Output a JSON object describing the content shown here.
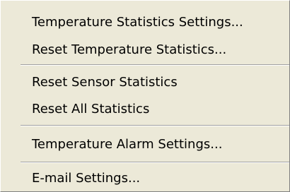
{
  "menu": {
    "items": [
      {
        "label": "Temperature Statistics Settings..."
      },
      {
        "label": "Reset Temperature Statistics..."
      },
      {
        "label": "Reset Sensor Statistics"
      },
      {
        "label": "Reset All Statistics"
      },
      {
        "label": "Temperature Alarm Settings..."
      },
      {
        "label": "E-mail Settings..."
      }
    ]
  }
}
